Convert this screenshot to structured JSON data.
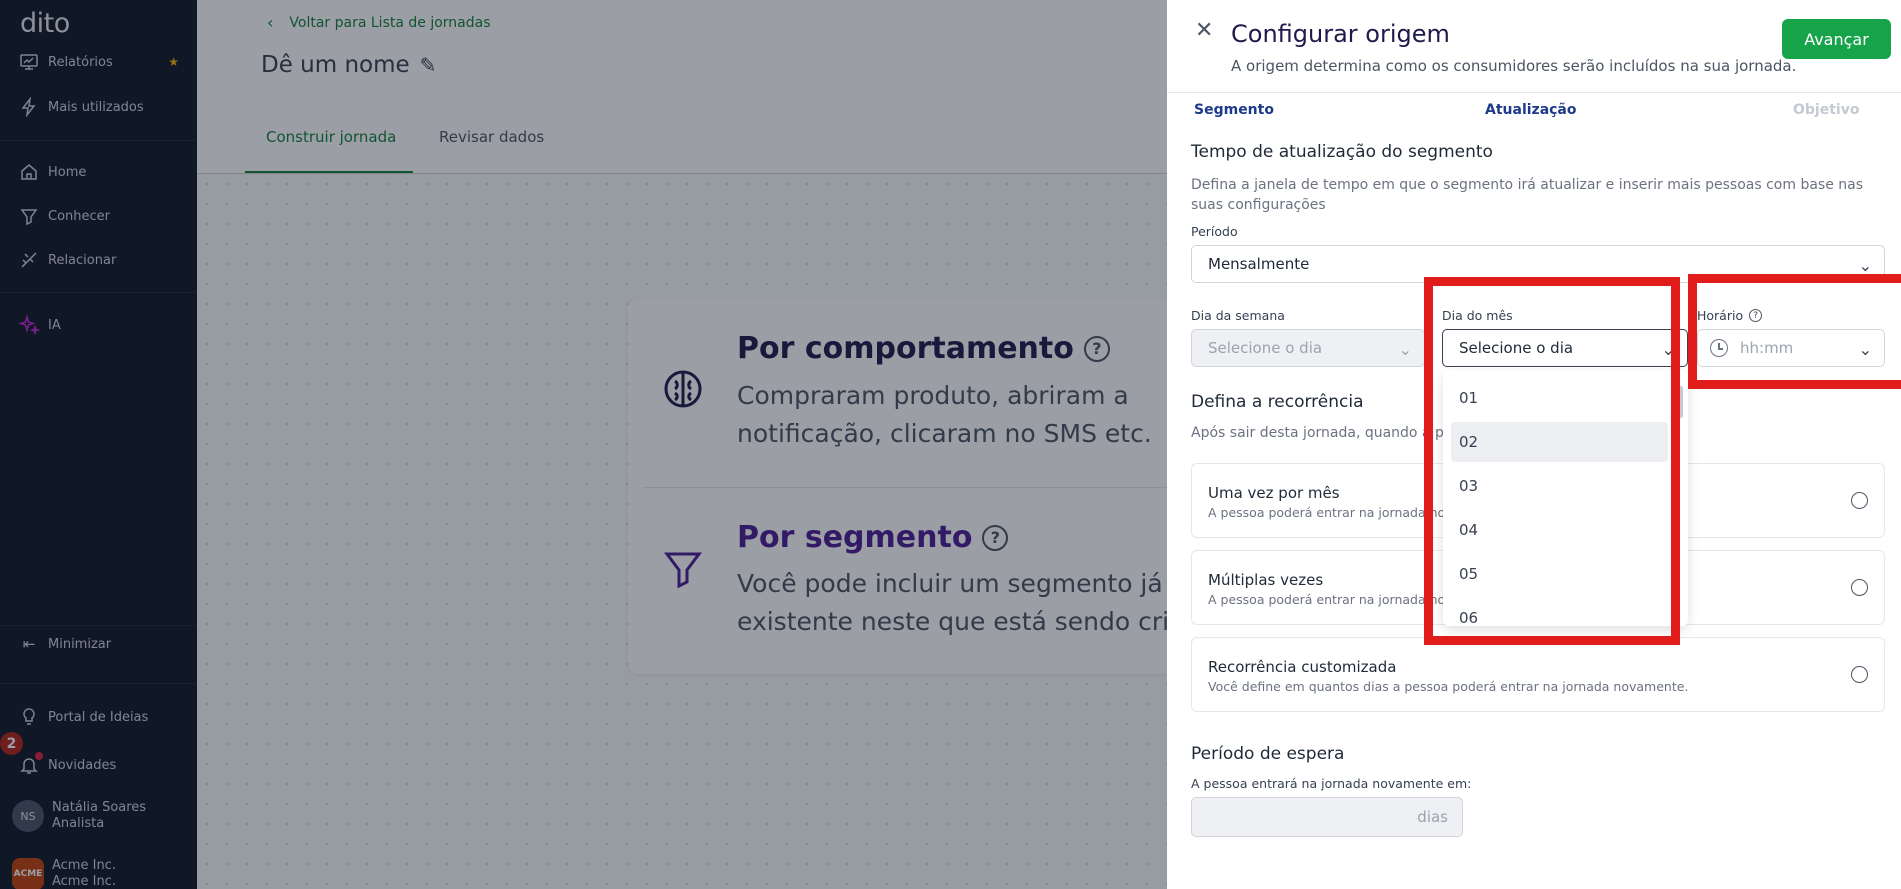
{
  "sidebar": {
    "logo": "dito",
    "items": [
      {
        "label": "Relatórios",
        "icon": "report-icon",
        "starred": true
      },
      {
        "label": "Mais utilizados",
        "icon": "lightning-icon"
      },
      {
        "label": "Home",
        "icon": "home-icon"
      },
      {
        "label": "Conhecer",
        "icon": "funnel-icon"
      },
      {
        "label": "Relacionar",
        "icon": "relationship-icon"
      },
      {
        "label": "IA",
        "icon": "sparkles-icon"
      }
    ],
    "minimize": "Minimizar",
    "ideas_portal": "Portal de Ideias",
    "news": "Novidades",
    "news_badge": "2",
    "user": {
      "initials": "NS",
      "name": "Natália Soares",
      "role": "Analista"
    },
    "org": {
      "logo_text": "ACME",
      "name": "Acme Inc.",
      "sub": "Acme Inc."
    }
  },
  "main": {
    "back_link": "Voltar para Lista de jornadas",
    "journey_name": "Dê um nome",
    "tabs": [
      {
        "label": "Construir jornada",
        "active": true
      },
      {
        "label": "Revisar dados",
        "active": false
      }
    ],
    "options": [
      {
        "title": "Por comportamento",
        "desc_line1": "Compraram produto, abriram a",
        "desc_line2": "notificação, clicaram no SMS etc."
      },
      {
        "title": "Por segmento",
        "desc_line1": "Você pode incluir um segmento já",
        "desc_line2": "existente neste que está sendo criado"
      }
    ]
  },
  "drawer": {
    "title": "Configurar origem",
    "subtitle": "A origem determina como os consumidores serão incluídos na sua jornada.",
    "next_button": "Avançar",
    "steps": [
      "Segmento",
      "Atualização",
      "Objetivo"
    ],
    "update_section": {
      "title": "Tempo de atualização do segmento",
      "help_line1": "Defina a janela de tempo em que o segmento irá atualizar e inserir mais pessoas com base nas",
      "help_line2": "suas configurações",
      "period_label": "Período",
      "period_value": "Mensalmente",
      "weekday_label": "Dia da semana",
      "weekday_placeholder": "Selecione o dia",
      "monthday_label": "Dia do mês",
      "monthday_placeholder": "Selecione o dia",
      "time_label": "Horário",
      "time_placeholder": "hh:mm"
    },
    "day_options": [
      "01",
      "02",
      "03",
      "04",
      "05",
      "06"
    ],
    "recurrence": {
      "title": "Defina a recorrência",
      "help": "Após sair desta jornada, quando a p",
      "options": [
        {
          "title": "Uma vez por mês",
          "desc": "A pessoa poderá entrar na jornada nov"
        },
        {
          "title": "Múltiplas vezes",
          "desc": "A pessoa poderá entrar na jornada nov"
        },
        {
          "title": "Recorrência customizada",
          "desc": "Você define em quantos dias a pessoa poderá entrar na jornada novamente."
        }
      ]
    },
    "wait": {
      "title": "Período de espera",
      "label": "A pessoa entrará na jornada novamente em:",
      "suffix": "dias"
    }
  },
  "colors": {
    "sidebar_bg": "#101828",
    "brand_green": "#16a34a",
    "highlight_red": "#e21b1b",
    "title_navy": "#1e1b4b"
  }
}
